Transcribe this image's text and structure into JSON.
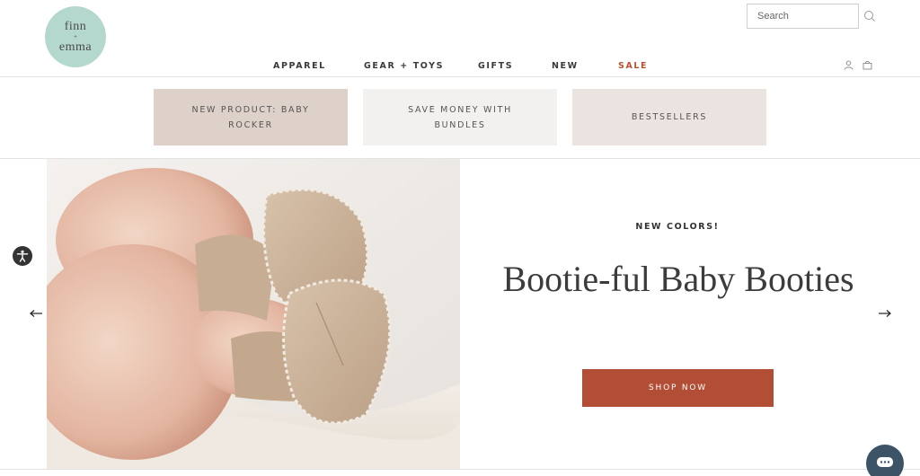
{
  "brand": {
    "line1": "finn",
    "line2": "+",
    "line3": "emma"
  },
  "search": {
    "placeholder": "Search"
  },
  "nav": {
    "items": [
      {
        "label": "APPAREL"
      },
      {
        "label": "GEAR + TOYS"
      },
      {
        "label": "GIFTS"
      },
      {
        "label": "NEW"
      },
      {
        "label": "SALE"
      }
    ]
  },
  "promos": [
    {
      "label": "NEW PRODUCT: BABY ROCKER"
    },
    {
      "label": "SAVE MONEY WITH BUNDLES"
    },
    {
      "label": "BESTSELLERS"
    }
  ],
  "hero": {
    "eyebrow": "NEW COLORS!",
    "headline": "Bootie-ful Baby Booties",
    "cta": "SHOP NOW"
  },
  "colors": {
    "logo_bg": "#b5d8ce",
    "sale": "#b9532f",
    "cta_bg": "#b34e36",
    "promo_1": "#ddd1c9",
    "promo_2": "#f3f1ef",
    "promo_3": "#ebe3df"
  },
  "icons": {
    "search": "search-icon",
    "account": "user-icon",
    "cart": "bag-icon",
    "prev": "arrow-left-icon",
    "next": "arrow-right-icon",
    "accessibility": "accessibility-icon",
    "chat": "chat-icon"
  }
}
